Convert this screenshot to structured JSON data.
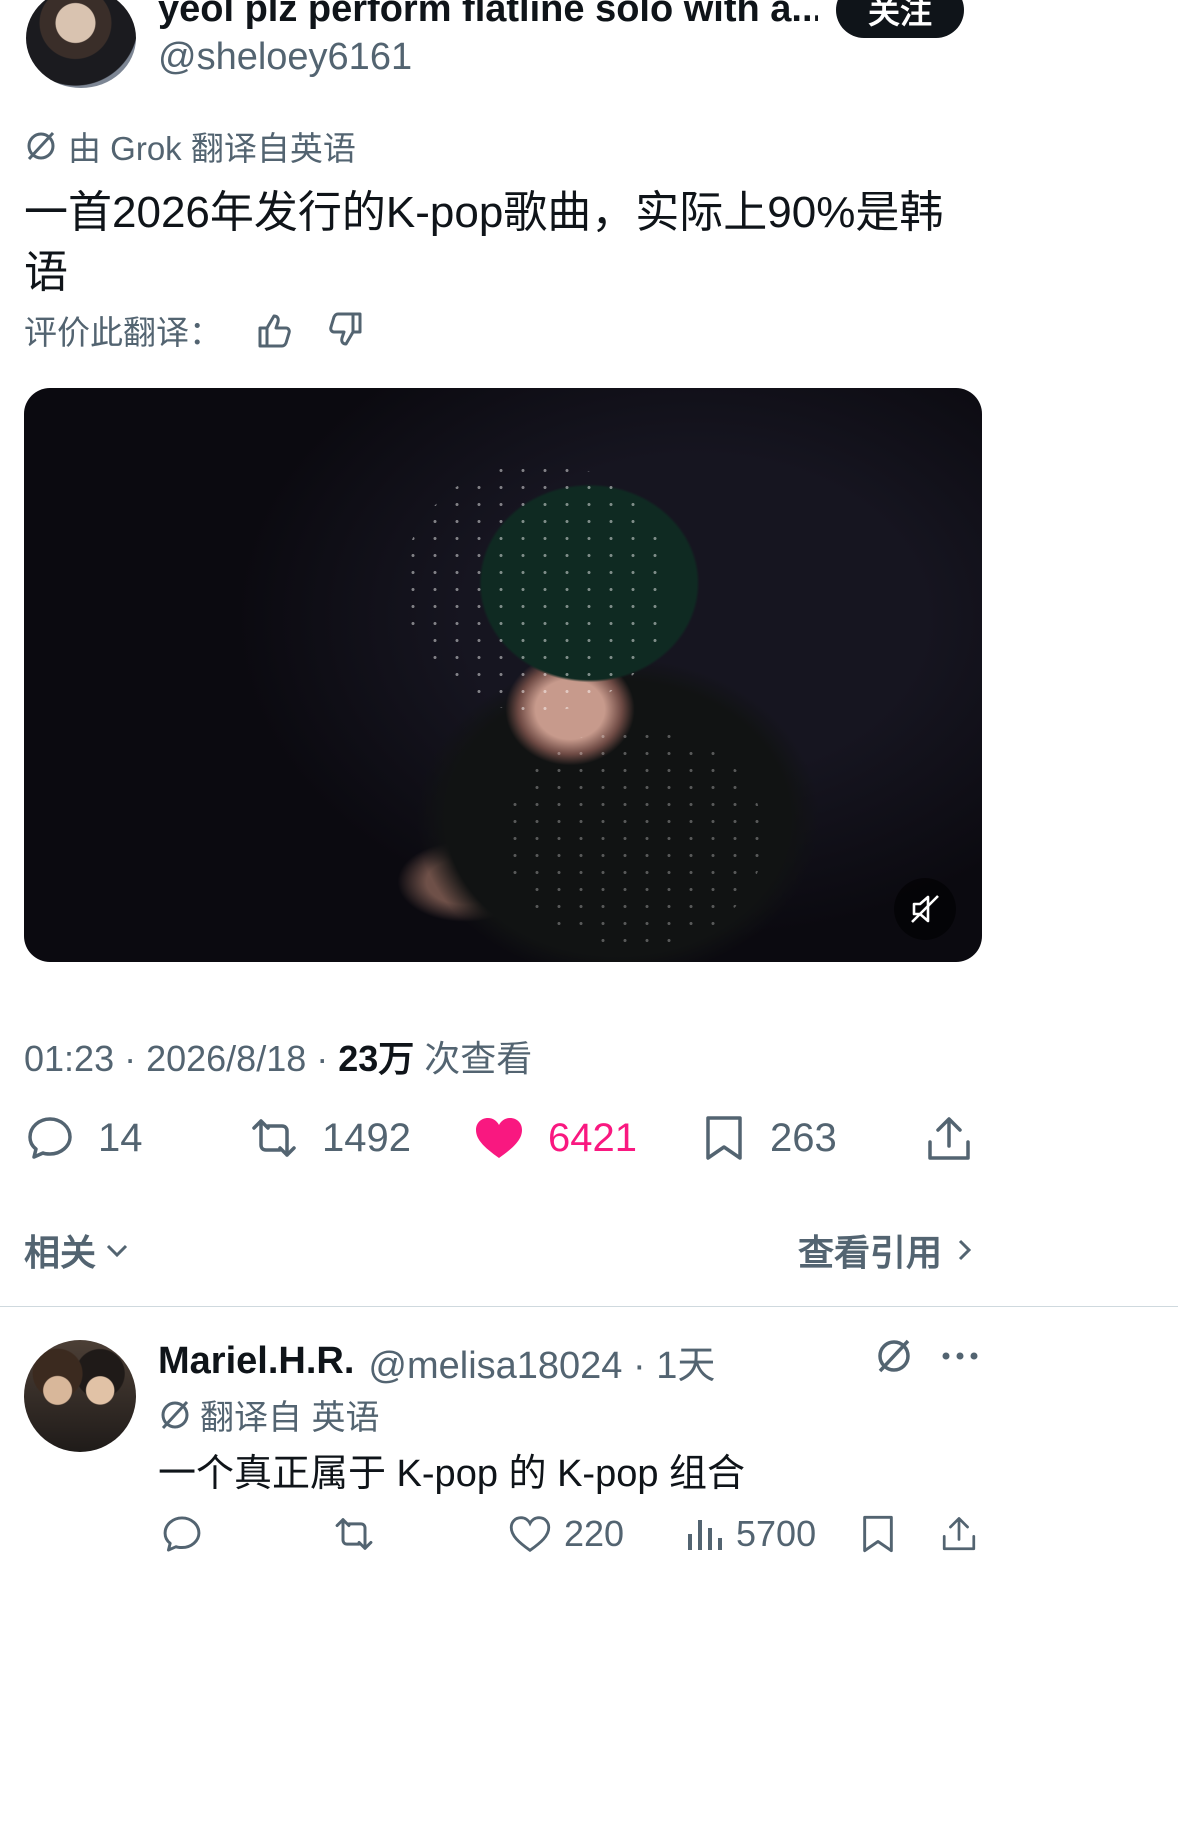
{
  "tweet": {
    "display_name": "yeol plz perform flatline solo with a...",
    "handle": "@sheloey6161",
    "follow_label": "关注",
    "translated_by": "由 Grok 翻译自英语",
    "text_line1": "一首2026年发行的K-pop歌曲，实际上90%是韩",
    "text_line2": "语",
    "rate_translation": "评价此翻译：",
    "meta_time": "01:23 · 2026/8/18 · ",
    "meta_views_count": "23万",
    "meta_views_label": " 次查看",
    "stats": {
      "replies": "14",
      "retweets": "1492",
      "likes": "6421",
      "bookmarks": "263"
    }
  },
  "related_label": "相关",
  "view_quotes_label": "查看引用",
  "reply": {
    "display_name": "Mariel.H.R.",
    "handle_time": "@melisa18024 · 1天",
    "translated_from": "翻译自 英语",
    "text": "一个真正属于 K-pop 的 K-pop 组合",
    "stats": {
      "likes": "220",
      "views": "5700"
    }
  },
  "colors": {
    "like_pink": "#f91880",
    "text_gray": "#536471",
    "text_dark": "#0f1419"
  }
}
